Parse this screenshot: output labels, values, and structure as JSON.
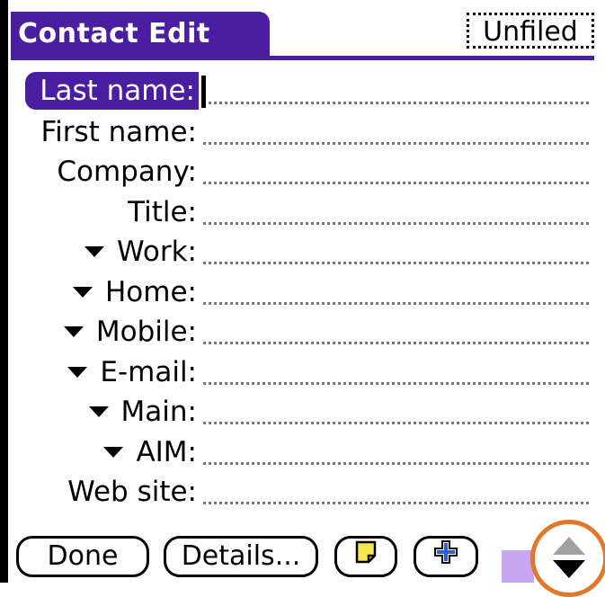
{
  "header": {
    "title": "Contact Edit",
    "category": "Unfiled"
  },
  "fields": [
    {
      "label": "Last name:",
      "active": true,
      "dropdown": false
    },
    {
      "label": "First name:",
      "active": false,
      "dropdown": false
    },
    {
      "label": "Company:",
      "active": false,
      "dropdown": false
    },
    {
      "label": "Title:",
      "active": false,
      "dropdown": false
    },
    {
      "label": "Work:",
      "active": false,
      "dropdown": true
    },
    {
      "label": "Home:",
      "active": false,
      "dropdown": true
    },
    {
      "label": "Mobile:",
      "active": false,
      "dropdown": true
    },
    {
      "label": "E-mail:",
      "active": false,
      "dropdown": true
    },
    {
      "label": "Main:",
      "active": false,
      "dropdown": true
    },
    {
      "label": "AIM:",
      "active": false,
      "dropdown": true
    },
    {
      "label": "Web site:",
      "active": false,
      "dropdown": false
    }
  ],
  "buttons": {
    "done": "Done",
    "details": "Details..."
  },
  "icons": {
    "note": "note-icon",
    "add": "plus-icon",
    "scroll_up": "scroll-up-arrow-icon",
    "scroll_down": "scroll-down-arrow-icon",
    "field_dropdown": "triangle-down-icon"
  },
  "colors": {
    "accent": "#4a1ea0",
    "highlight_ring": "#e2772a",
    "note_yellow": "#f5e64b",
    "add_blue": "#2a5fd4",
    "square": "#c8a6f2"
  }
}
